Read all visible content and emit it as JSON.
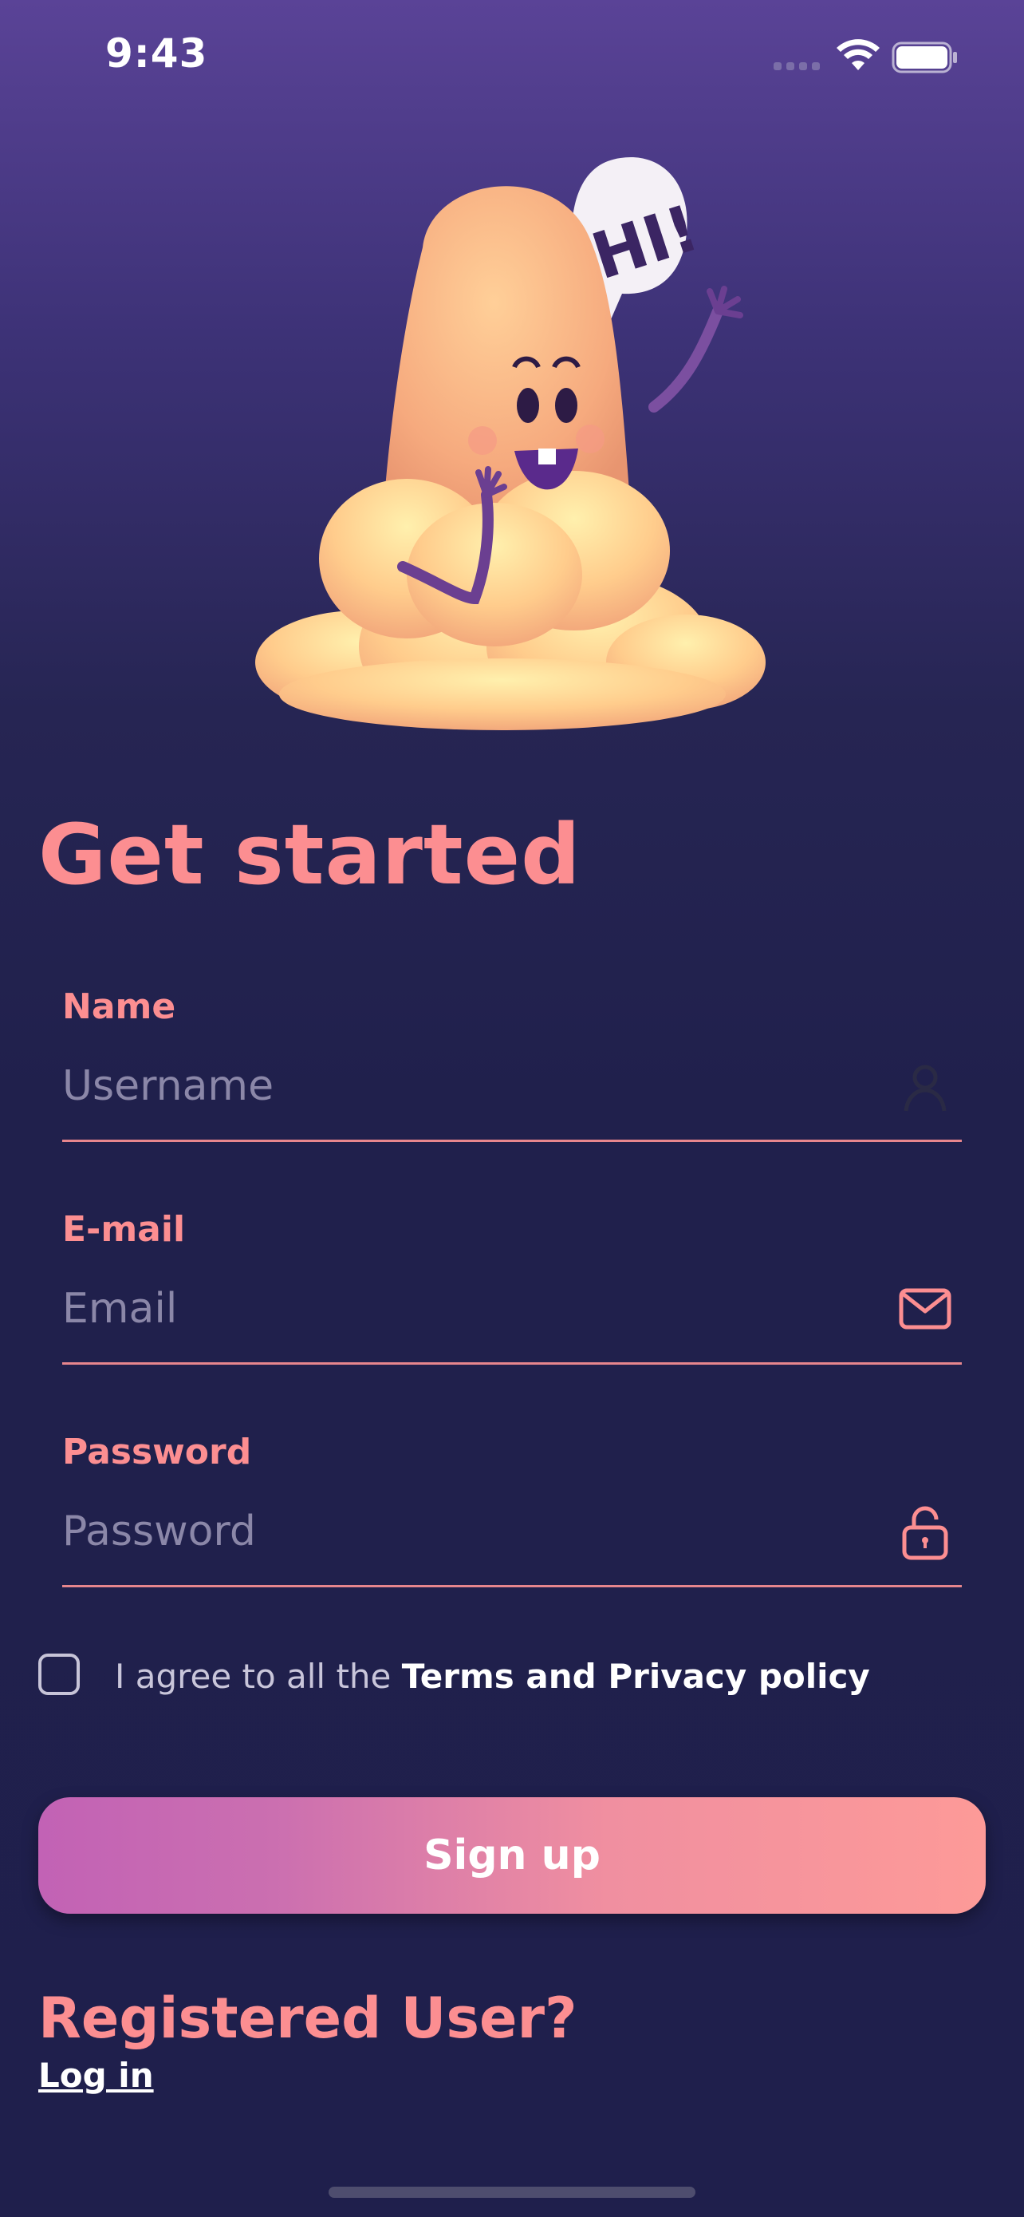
{
  "status_bar": {
    "time": "9:43"
  },
  "title": "Get started",
  "form": {
    "name": {
      "label": "Name",
      "placeholder": "Username",
      "icon": "user-icon"
    },
    "email": {
      "label": "E-mail",
      "placeholder": "Email",
      "icon": "mail-icon"
    },
    "password": {
      "label": "Password",
      "placeholder": "Password",
      "icon": "unlock-icon"
    }
  },
  "agreement": {
    "prefix": "I agree to all the ",
    "link": "Terms and Privacy policy",
    "checked": false
  },
  "signup_label": "Sign up",
  "registered": {
    "question": "Registered User?",
    "login_label": "Log in"
  },
  "hero": {
    "speech_text": "HI!"
  },
  "colors": {
    "accent": "#fc8e91",
    "background": "#1f1f4c",
    "button_start": "#c262b5",
    "button_end": "#fd9a98"
  }
}
